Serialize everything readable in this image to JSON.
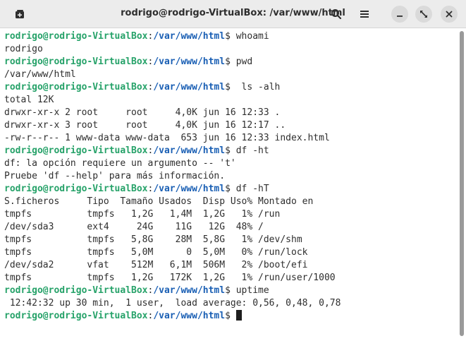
{
  "window": {
    "title": "rodrigo@rodrigo-VirtualBox: /var/www/html"
  },
  "titlebar": {
    "new_tab_icon": "new-tab-icon",
    "search_icon": "search-icon",
    "menu_icon": "hamburger-menu-icon",
    "minimize_icon": "minimize-icon",
    "maximize_icon": "maximize-icon",
    "close_icon": "close-icon"
  },
  "colors": {
    "prompt_user": "#26a269",
    "prompt_path": "#1a5fb4",
    "text": "#2e2e2e",
    "background": "#ffffff"
  },
  "terminal": {
    "lines": [
      {
        "type": "prompt",
        "user": "rodrigo@rodrigo-VirtualBox",
        "sep": ":",
        "path": "/var/www/html",
        "symbol": "$",
        "cmd": " whoami"
      },
      {
        "type": "output",
        "text": "rodrigo"
      },
      {
        "type": "prompt",
        "user": "rodrigo@rodrigo-VirtualBox",
        "sep": ":",
        "path": "/var/www/html",
        "symbol": "$",
        "cmd": " pwd"
      },
      {
        "type": "output",
        "text": "/var/www/html"
      },
      {
        "type": "prompt",
        "user": "rodrigo@rodrigo-VirtualBox",
        "sep": ":",
        "path": "/var/www/html",
        "symbol": "$",
        "cmd": "  ls -alh"
      },
      {
        "type": "output",
        "text": "total 12K"
      },
      {
        "type": "output",
        "text": "drwxr-xr-x 2 root     root     4,0K jun 16 12:33 ."
      },
      {
        "type": "output",
        "text": "drwxr-xr-x 3 root     root     4,0K jun 16 12:17 .."
      },
      {
        "type": "output",
        "text": "-rw-r--r-- 1 www-data www-data  653 jun 16 12:33 index.html"
      },
      {
        "type": "prompt",
        "user": "rodrigo@rodrigo-VirtualBox",
        "sep": ":",
        "path": "/var/www/html",
        "symbol": "$",
        "cmd": " df -ht"
      },
      {
        "type": "output",
        "text": "df: la opción requiere un argumento -- 't'"
      },
      {
        "type": "output",
        "text": "Pruebe 'df --help' para más información."
      },
      {
        "type": "prompt",
        "user": "rodrigo@rodrigo-VirtualBox",
        "sep": ":",
        "path": "/var/www/html",
        "symbol": "$",
        "cmd": " df -hT"
      },
      {
        "type": "output",
        "text": "S.ficheros     Tipo  Tamaño Usados  Disp Uso% Montado en"
      },
      {
        "type": "output",
        "text": "tmpfs          tmpfs   1,2G   1,4M  1,2G   1% /run"
      },
      {
        "type": "output",
        "text": "/dev/sda3      ext4     24G    11G   12G  48% /"
      },
      {
        "type": "output",
        "text": "tmpfs          tmpfs   5,8G    28M  5,8G   1% /dev/shm"
      },
      {
        "type": "output",
        "text": "tmpfs          tmpfs   5,0M      0  5,0M   0% /run/lock"
      },
      {
        "type": "output",
        "text": "/dev/sda2      vfat    512M   6,1M  506M   2% /boot/efi"
      },
      {
        "type": "output",
        "text": "tmpfs          tmpfs   1,2G   172K  1,2G   1% /run/user/1000"
      },
      {
        "type": "prompt",
        "user": "rodrigo@rodrigo-VirtualBox",
        "sep": ":",
        "path": "/var/www/html",
        "symbol": "$",
        "cmd": " uptime"
      },
      {
        "type": "output",
        "text": " 12:42:32 up 30 min,  1 user,  load average: 0,56, 0,48, 0,78"
      },
      {
        "type": "prompt",
        "user": "rodrigo@rodrigo-VirtualBox",
        "sep": ":",
        "path": "/var/www/html",
        "symbol": "$",
        "cmd": " ",
        "cursor": true
      }
    ]
  }
}
